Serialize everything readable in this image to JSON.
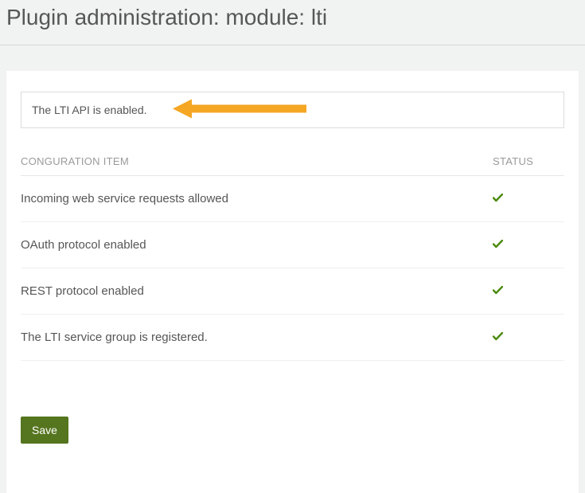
{
  "header": {
    "title": "Plugin administration: module: lti"
  },
  "alert": {
    "text": "The LTI API is enabled."
  },
  "table": {
    "columns": {
      "item": "Conguration item",
      "status": "Status"
    },
    "rows": [
      {
        "item": "Incoming web service requests allowed",
        "status": "ok"
      },
      {
        "item": "OAuth protocol enabled",
        "status": "ok"
      },
      {
        "item": "REST protocol enabled",
        "status": "ok"
      },
      {
        "item": "The LTI service group is registered.",
        "status": "ok"
      }
    ]
  },
  "buttons": {
    "save": "Save"
  },
  "colors": {
    "accent": "#55751f",
    "arrow": "#f5a623"
  }
}
